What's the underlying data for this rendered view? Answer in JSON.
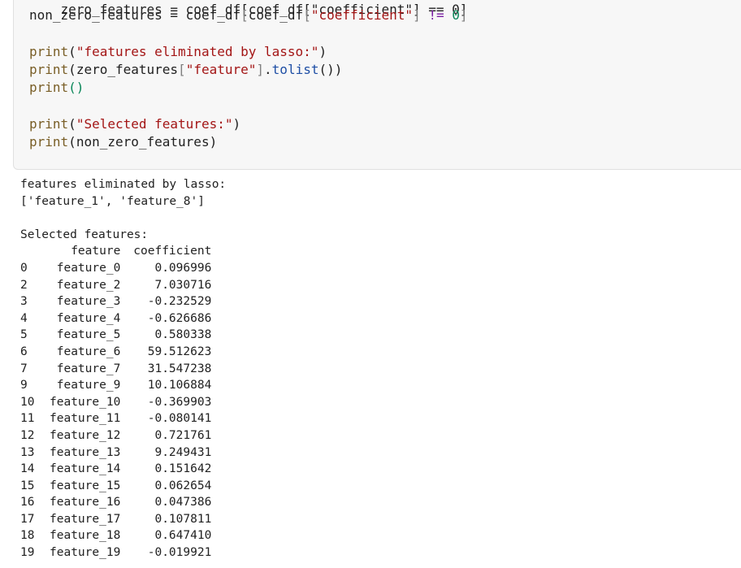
{
  "code_cell": {
    "line_top_partial": "zero_features = coef_df[coef_df[\"coefficient\"] == 0]",
    "line_nonzero": {
      "var": "non_zero_features",
      "eq": " = ",
      "df1": "coef_df",
      "lb1": "[",
      "df2": "coef_df",
      "lb2": "[",
      "str": "\"coefficient\"",
      "rb2": "]",
      "op": " != ",
      "num": "0",
      "rb1": "]"
    },
    "line_print1": {
      "fn": "print",
      "open": "(",
      "str": "\"features eliminated by lasso:\"",
      "close": ")"
    },
    "line_print2": {
      "fn": "print",
      "open": "(",
      "var": "zero_features",
      "lb": "[",
      "str": "\"feature\"",
      "rb": "]",
      "dot": ".",
      "method": "tolist",
      "call": "())"
    },
    "line_print3": {
      "fn": "print",
      "call": "()"
    },
    "line_print4": {
      "fn": "print",
      "open": "(",
      "str": "\"Selected features:\"",
      "close": ")"
    },
    "line_print5": {
      "fn": "print",
      "open": "(",
      "var": "non_zero_features",
      "close": ")"
    }
  },
  "output": {
    "eliminated_header": "features eliminated by lasso:",
    "eliminated_list": "['feature_1', 'feature_8']",
    "selected_header": "Selected features:",
    "table": {
      "columns": [
        "",
        "feature",
        "coefficient"
      ],
      "rows": [
        [
          "0",
          "feature_0",
          "0.096996"
        ],
        [
          "2",
          "feature_2",
          "7.030716"
        ],
        [
          "3",
          "feature_3",
          "-0.232529"
        ],
        [
          "4",
          "feature_4",
          "-0.626686"
        ],
        [
          "5",
          "feature_5",
          "0.580338"
        ],
        [
          "6",
          "feature_6",
          "59.512623"
        ],
        [
          "7",
          "feature_7",
          "31.547238"
        ],
        [
          "9",
          "feature_9",
          "10.106884"
        ],
        [
          "10",
          "feature_10",
          "-0.369903"
        ],
        [
          "11",
          "feature_11",
          "-0.080141"
        ],
        [
          "12",
          "feature_12",
          "0.721761"
        ],
        [
          "13",
          "feature_13",
          "9.249431"
        ],
        [
          "14",
          "feature_14",
          "0.151642"
        ],
        [
          "15",
          "feature_15",
          "0.062654"
        ],
        [
          "16",
          "feature_16",
          "0.047386"
        ],
        [
          "17",
          "feature_17",
          "0.107811"
        ],
        [
          "18",
          "feature_18",
          "0.647410"
        ],
        [
          "19",
          "feature_19",
          "-0.019921"
        ]
      ]
    }
  }
}
